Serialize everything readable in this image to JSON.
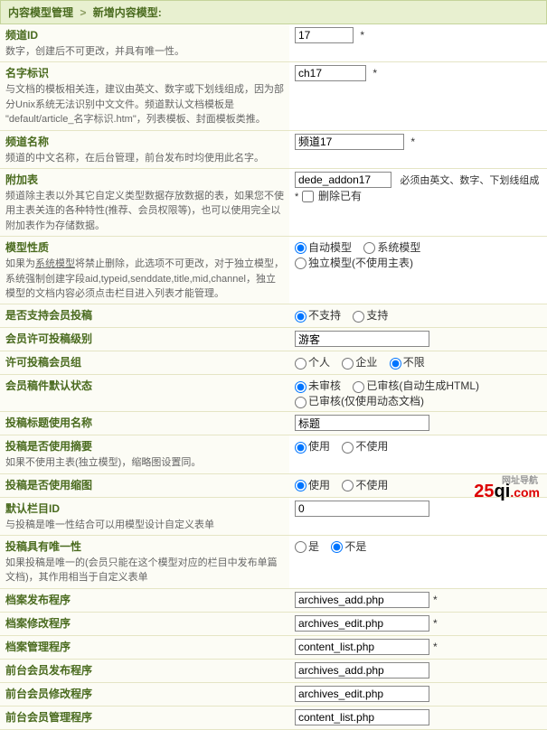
{
  "header": {
    "a": "内容模型管理",
    "sep": ">",
    "b": "新增内容模型:"
  },
  "rows": {
    "channel_id": {
      "title": "频道ID",
      "desc": "数字，创建后不可更改，并具有唯一性。",
      "value": "17"
    },
    "name_mark": {
      "title": "名字标识",
      "desc": "与文档的模板相关连，建议由英文、数字或下划线组成，因为部分Unix系统无法识别中文文件。频道默认文档模板是 \"default/article_名字标识.htm\"，列表模板、封面模板类推。",
      "value": "ch17"
    },
    "channel_name": {
      "title": "频道名称",
      "desc": "频道的中文名称，在后台管理，前台发布时均使用此名字。",
      "value": "频道17"
    },
    "addon": {
      "title": "附加表",
      "desc": "频道除主表以外其它自定义类型数据存放数据的表，如果您不使用主表关连的各种特性(推荐、会员权限等)，也可以使用完全以附加表作为存储数据。",
      "value": "dede_addon17",
      "note": "必须由英文、数字、下划线组成 *",
      "cb": "删除已有"
    },
    "model_type": {
      "title": "模型性质",
      "desc": "如果为",
      "u": "系统模型",
      "desc2": "将禁止删除，此选项不可更改，对于独立模型，系统强制创建字段aid,typeid,senddate,title,mid,channel，独立模型的文档内容必须点击栏目进入列表才能管理。",
      "o1": "自动模型",
      "o2": "系统模型",
      "o3": "独立模型(不使用主表)"
    },
    "member_post": {
      "title": "是否支持会员投稿",
      "o1": "不支持",
      "o2": "支持"
    },
    "member_level": {
      "title": "会员许可投稿级别",
      "value": "游客"
    },
    "member_group": {
      "title": "许可投稿会员组",
      "o1": "个人",
      "o2": "企业",
      "o3": "不限"
    },
    "default_status": {
      "title": "会员稿件默认状态",
      "o1": "未审核",
      "o2": "已审核(自动生成HTML)",
      "o3": "已审核(仅使用动态文档)"
    },
    "title_name": {
      "title": "投稿标题使用名称",
      "value": "标题"
    },
    "use_summary": {
      "title": "投稿是否使用摘要",
      "desc": "如果不使用主表(独立模型)，缩略图设置同。",
      "o1": "使用",
      "o2": "不使用"
    },
    "use_thumb": {
      "title": "投稿是否使用缩图",
      "o1": "使用",
      "o2": "不使用"
    },
    "default_cat": {
      "title": "默认栏目ID",
      "desc": "与投稿是唯一性结合可以用模型设计自定义表单",
      "value": "0"
    },
    "unique": {
      "title": "投稿具有唯一性",
      "desc": "如果投稿是唯一的(会员只能在这个模型对应的栏目中发布单篇文档)，其作用相当于自定义表单",
      "o1": "是",
      "o2": "不是"
    },
    "doc_pub": {
      "title": "档案发布程序",
      "value": "archives_add.php"
    },
    "doc_edit": {
      "title": "档案修改程序",
      "value": "archives_edit.php"
    },
    "doc_mgr": {
      "title": "档案管理程序",
      "value": "content_list.php"
    },
    "front_pub": {
      "title": "前台会员发布程序",
      "value": "archives_add.php"
    },
    "front_edit": {
      "title": "前台会员修改程序",
      "value": "archives_edit.php"
    },
    "front_mgr": {
      "title": "前台会员管理程序",
      "value": "content_list.php"
    }
  },
  "watermark": {
    "red": "25",
    "q": "qi",
    "com": ".com",
    "sub": "网址导航"
  }
}
